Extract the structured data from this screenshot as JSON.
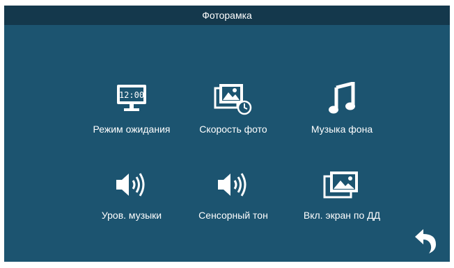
{
  "header": {
    "title": "Фоторамка"
  },
  "menu": [
    {
      "label": "Режим ожидания",
      "icon": "monitor-clock-icon",
      "clock": "12:00"
    },
    {
      "label": "Скорость фото",
      "icon": "photo-speed-icon"
    },
    {
      "label": "Музыка фона",
      "icon": "music-note-icon"
    },
    {
      "label": "Уров. музыки",
      "icon": "volume-icon"
    },
    {
      "label": "Сенсорный тон",
      "icon": "volume-icon"
    },
    {
      "label": "Вкл. экран по ДД",
      "icon": "photo-stack-icon"
    }
  ],
  "controls": {
    "back_icon": "back-arrow-icon"
  },
  "colors": {
    "background": "#1c5470",
    "titlebar": "#14384c",
    "text": "#ffffff"
  }
}
